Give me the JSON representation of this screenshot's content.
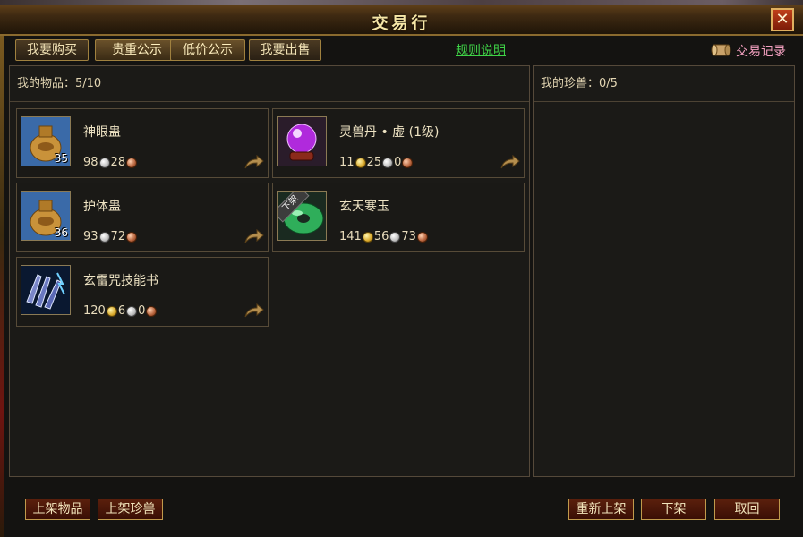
{
  "window": {
    "title": "交易行",
    "close_label": "✕"
  },
  "tabs": [
    {
      "label": "我要购买",
      "active": false
    },
    {
      "label": "贵重公示",
      "active": true
    },
    {
      "label": "低价公示",
      "active": true
    },
    {
      "label": "我要出售",
      "active": false
    }
  ],
  "rules_link": "规则说明",
  "records_label": "交易记录",
  "my_items": {
    "header": "我的物品：5/10",
    "items": [
      {
        "name": "神眼蛊",
        "level": "35",
        "price": [
          "98",
          "28"
        ],
        "coins": [
          "silver",
          "copper"
        ],
        "icon": "gourd-icon"
      },
      {
        "name": "灵兽丹 • 虚 (1级)",
        "level": "",
        "price": [
          "11",
          "25",
          "0"
        ],
        "coins": [
          "gold",
          "silver",
          "copper"
        ],
        "icon": "crystal-ball-icon"
      },
      {
        "name": "护体蛊",
        "level": "36",
        "price": [
          "93",
          "72"
        ],
        "coins": [
          "silver",
          "copper"
        ],
        "icon": "gourd-icon"
      },
      {
        "name": "玄天寒玉",
        "level": "",
        "price": [
          "141",
          "56",
          "73"
        ],
        "coins": [
          "gold",
          "silver",
          "copper"
        ],
        "icon": "jade-icon",
        "badge": "下架"
      },
      {
        "name": "玄雷咒技能书",
        "level": "",
        "price": [
          "120",
          "6",
          "0"
        ],
        "coins": [
          "gold",
          "silver",
          "copper"
        ],
        "icon": "thunder-claw-icon"
      }
    ]
  },
  "my_pets": {
    "header": "我的珍兽：0/5"
  },
  "buttons": {
    "list_item": "上架物品",
    "list_pet": "上架珍兽",
    "relist": "重新上架",
    "delist": "下架",
    "cancel": "取回"
  },
  "colors": {
    "rules_link": "#3fd447",
    "records": "#f3a0c0",
    "frame_gold": "#a0813f"
  }
}
